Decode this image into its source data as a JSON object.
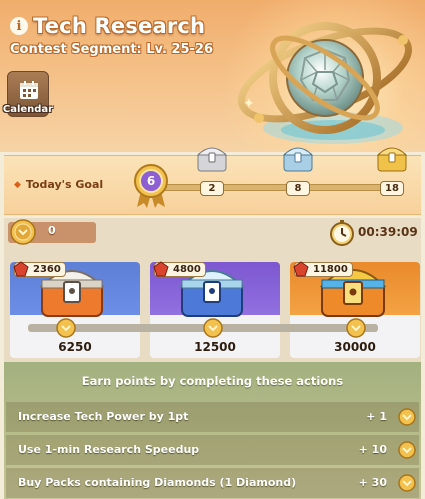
{
  "header": {
    "title": "Tech Research",
    "subtitle": "Contest Segment: Lv. 25-26",
    "calendar_label": "Calendar"
  },
  "goal": {
    "label": "Today's Goal",
    "current_level": "6",
    "milestones": [
      "2",
      "8",
      "18"
    ]
  },
  "status": {
    "points": "0",
    "timer": "00:39:09"
  },
  "chests": [
    {
      "cost": "2360",
      "required": "6250",
      "color": "#5e7fd6"
    },
    {
      "cost": "4800",
      "required": "12500",
      "color": "#7d57d0"
    },
    {
      "cost": "11800",
      "required": "30000",
      "color": "#ea8a2c"
    }
  ],
  "actions": {
    "title": "Earn points by completing these actions",
    "items": [
      {
        "label": "Increase Tech Power by 1pt",
        "points": "+ 1"
      },
      {
        "label": "Use 1-min Research Speedup",
        "points": "+ 10"
      },
      {
        "label": "Buy Packs containing Diamonds (1 Diamond)",
        "points": "+ 30"
      }
    ]
  },
  "icons": {
    "info": "info-icon",
    "calendar": "calendar-icon",
    "coin": "research-coin-icon",
    "timer": "stopwatch-icon",
    "gem": "red-gem-icon",
    "chest": "chest-icon"
  }
}
